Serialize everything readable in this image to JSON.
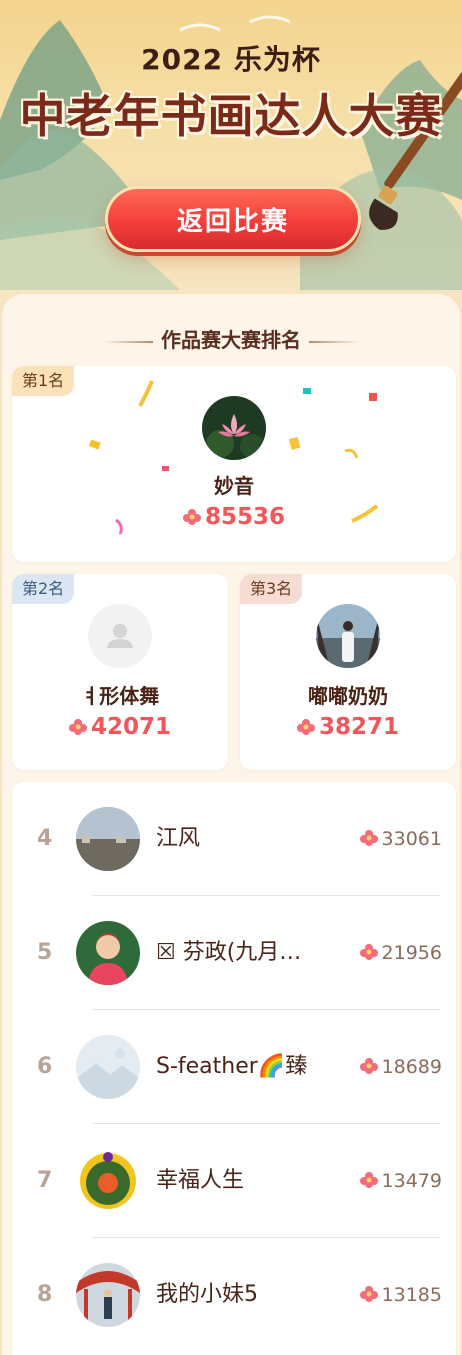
{
  "hero": {
    "year": "2022 乐为杯",
    "title": "中老年书画达人大赛",
    "back_button": "返回比赛"
  },
  "section": {
    "title": "作品赛大赛排名"
  },
  "podium": [
    {
      "rank_label": "第1名",
      "name": "妙音",
      "score": "85536"
    },
    {
      "rank_label": "第2名",
      "name": "ㅕ形体舞",
      "score": "42071"
    },
    {
      "rank_label": "第3名",
      "name": "嘟嘟奶奶",
      "score": "38271"
    }
  ],
  "list": [
    {
      "rank": "4",
      "name": "江风",
      "score": "33061"
    },
    {
      "rank": "5",
      "name": "☒ 芬政(九月…",
      "score": "21956"
    },
    {
      "rank": "6",
      "name": "S-feather🌈臻",
      "score": "18689"
    },
    {
      "rank": "7",
      "name": "幸福人生",
      "score": "13479"
    },
    {
      "rank": "8",
      "name": "我的小妹5",
      "score": "13185"
    }
  ],
  "colors": {
    "accent_red": "#f0565a",
    "button_red": "#f33f3b",
    "brown_text": "#4a2416",
    "panel_bg": "#fdf4ea"
  },
  "icons": [
    "flower-icon",
    "default-avatar-icon",
    "brush-icon",
    "mountain-illustration"
  ]
}
